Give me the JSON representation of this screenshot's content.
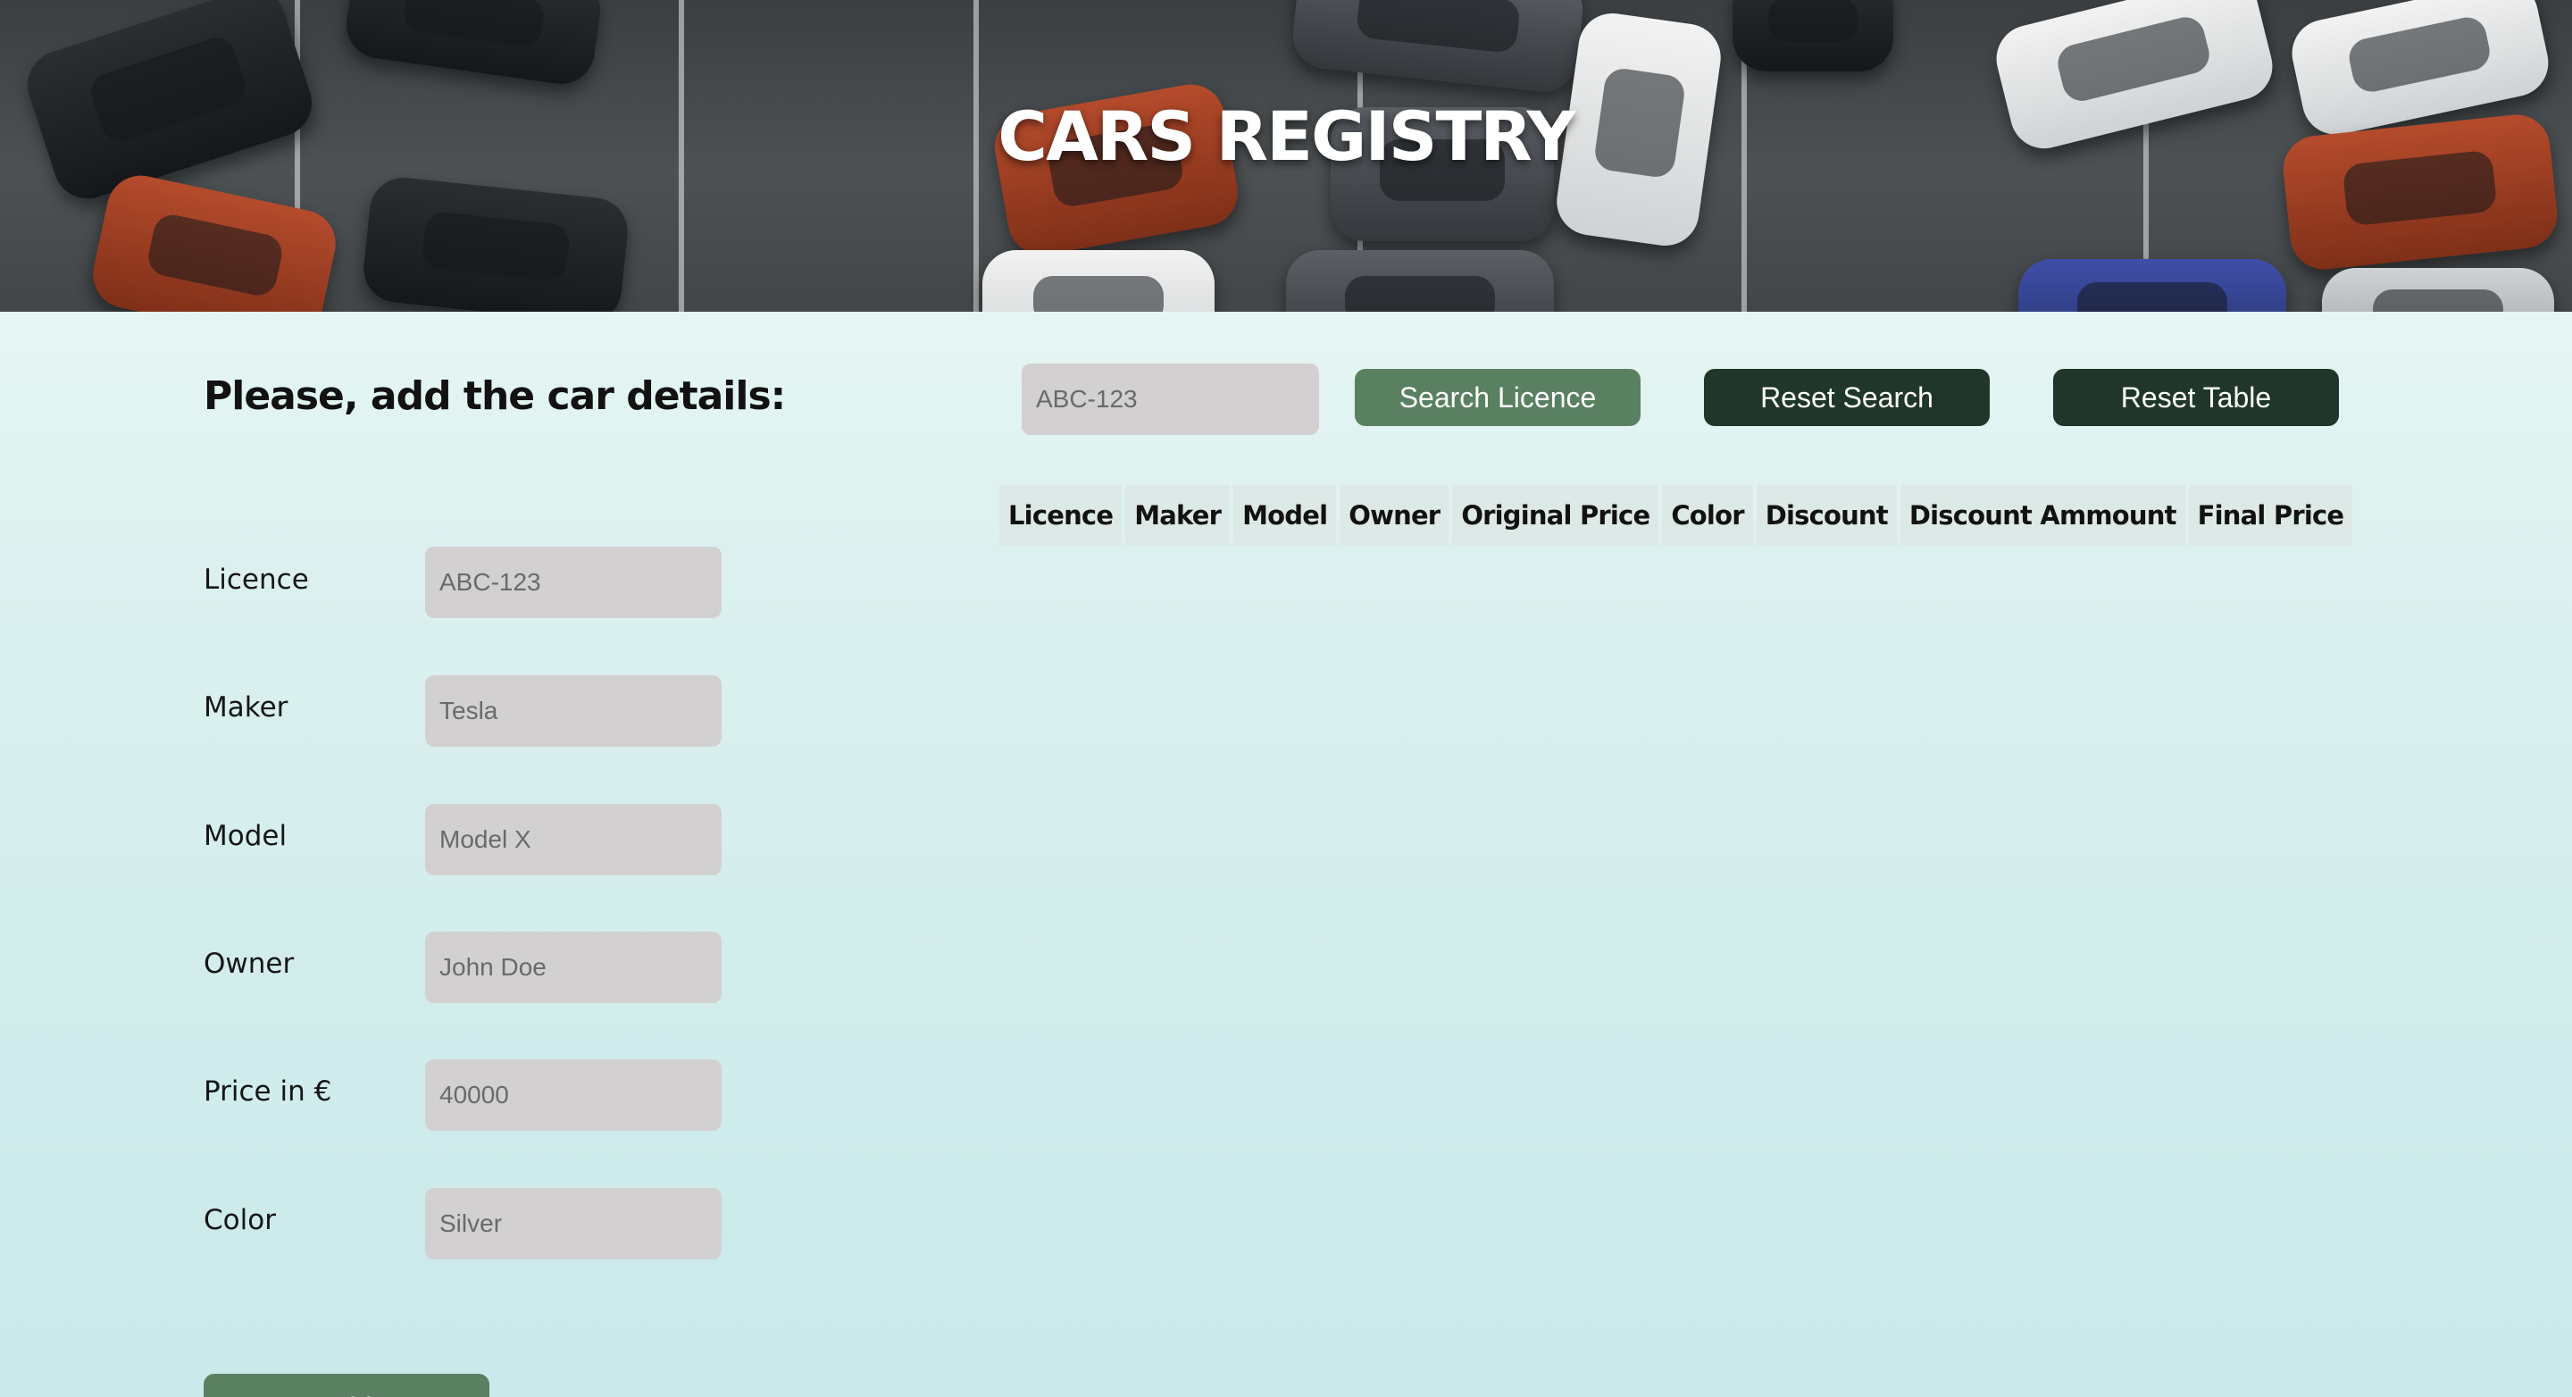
{
  "header": {
    "title": "CARS REGISTRY"
  },
  "form": {
    "title": "Please, add the car details:",
    "fields": [
      {
        "label": "Licence",
        "placeholder": "ABC-123"
      },
      {
        "label": "Maker",
        "placeholder": "Tesla"
      },
      {
        "label": "Model",
        "placeholder": "Model X"
      },
      {
        "label": "Owner",
        "placeholder": "John Doe"
      },
      {
        "label": "Price in €",
        "placeholder": "40000"
      },
      {
        "label": "Color",
        "placeholder": "Silver"
      }
    ],
    "add_label": "Add"
  },
  "search": {
    "placeholder": "ABC-123",
    "search_label": "Search Licence",
    "reset_search_label": "Reset Search",
    "reset_table_label": "Reset Table"
  },
  "table": {
    "columns": [
      "Licence",
      "Maker",
      "Model",
      "Owner",
      "Original Price",
      "Color",
      "Discount",
      "Discount Ammount",
      "Final Price"
    ]
  },
  "colors": {
    "primary_button": "#5a8062",
    "dark_button": "#21362a",
    "input_bg": "#d3d0d1",
    "table_header_bg": "#dde9e6"
  }
}
